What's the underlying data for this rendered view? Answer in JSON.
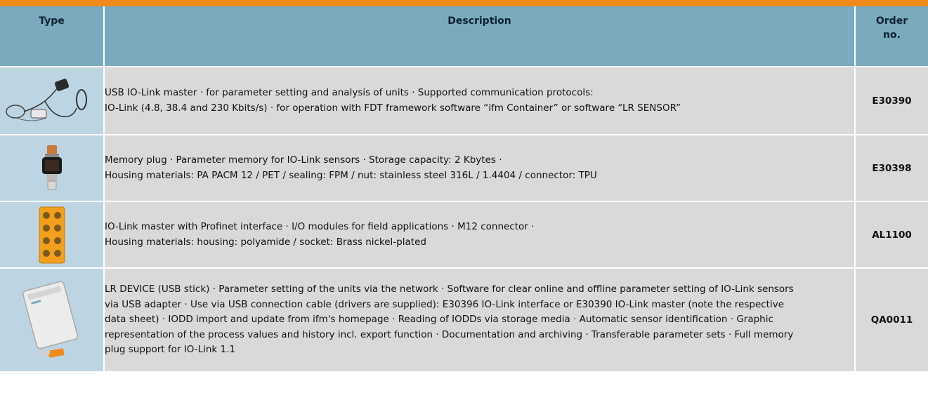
{
  "header": {
    "type": "Type",
    "description": "Description",
    "order": "Order no."
  },
  "rows": [
    {
      "icon": "usb-io-link-master-cable-icon",
      "lines": [
        "USB IO-Link master · for parameter setting and analysis of units · Supported communication protocols:",
        "IO-Link (4.8, 38.4 and 230 Kbits/s) · for operation with FDT framework software “ifm Container” or software “LR SENSOR”"
      ],
      "order_no": "E30390"
    },
    {
      "icon": "memory-plug-icon",
      "lines": [
        "Memory plug · Parameter memory for IO-Link sensors · Storage capacity: 2 Kbytes ·",
        "Housing materials: PA PACM 12 / PET / sealing: FPM / nut: stainless steel 316L / 1.4404 / connector: TPU"
      ],
      "order_no": "E30398"
    },
    {
      "icon": "io-link-master-module-icon",
      "lines": [
        "IO-Link master with Profinet interface · I/O modules for field applications · M12 connector ·",
        "Housing materials: housing: polyamide / socket: Brass nickel-plated"
      ],
      "order_no": "AL1100"
    },
    {
      "icon": "lr-device-usb-stick-icon",
      "text": "LR DEVICE (USB stick) · Parameter setting of the units via the network · Software for clear online and offline parameter setting of IO-Link sensors via USB adapter · Use via USB connection cable (drivers are supplied): E30396 IO-Link interface or E30390 IO-Link master (note the respective data sheet) · IODD import and update from ifm's homepage · Reading of IODDs via storage media · Automatic sensor identification · Graphic representation of the process values and history incl. export function · Documentation and archiving · Transferable parameter sets · Full memory plug support for IO-Link 1.1",
      "order_no": "QA0011"
    }
  ],
  "colors": {
    "top_bar": "#f08a1a",
    "header_bg": "#7aaabd",
    "row_bg": "#d9d9d9",
    "image_cell_bg": "#bdd5e2"
  }
}
